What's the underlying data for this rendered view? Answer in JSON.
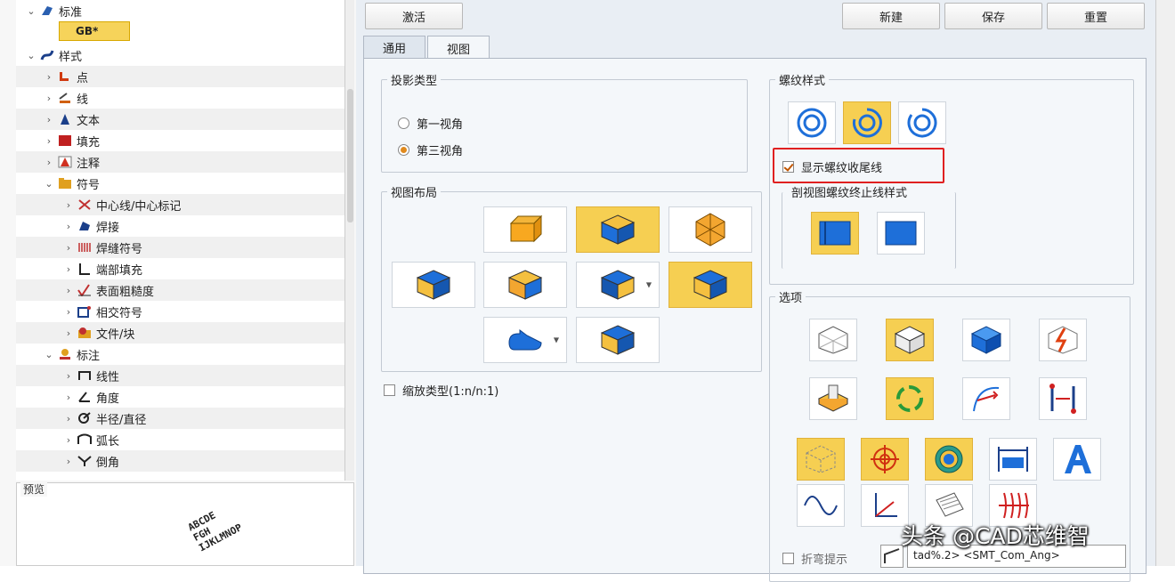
{
  "tree": {
    "gb_value": "GB*",
    "items": [
      {
        "label": "标准",
        "icon": "standard-icon"
      },
      {
        "label": "样式",
        "icon": "style-icon"
      },
      {
        "label": "点",
        "icon": "point-icon"
      },
      {
        "label": "线",
        "icon": "line-icon"
      },
      {
        "label": "文本",
        "icon": "text-icon"
      },
      {
        "label": "填充",
        "icon": "fill-icon"
      },
      {
        "label": "注释",
        "icon": "annotation-icon"
      },
      {
        "label": "符号",
        "icon": "symbol-icon"
      },
      {
        "label": "中心线/中心标记",
        "icon": "centerline-icon"
      },
      {
        "label": "焊接",
        "icon": "weld-icon"
      },
      {
        "label": "焊缝符号",
        "icon": "weld-symbol-icon"
      },
      {
        "label": "端部填充",
        "icon": "end-fill-icon"
      },
      {
        "label": "表面粗糙度",
        "icon": "roughness-icon"
      },
      {
        "label": "相交符号",
        "icon": "intersect-icon"
      },
      {
        "label": "文件/块",
        "icon": "file-block-icon"
      },
      {
        "label": "标注",
        "icon": "dimension-icon"
      },
      {
        "label": "线性",
        "icon": "linear-icon"
      },
      {
        "label": "角度",
        "icon": "angle-icon"
      },
      {
        "label": "半径/直径",
        "icon": "radius-icon"
      },
      {
        "label": "弧长",
        "icon": "arc-length-icon"
      },
      {
        "label": "倒角",
        "icon": "chamfer-icon"
      }
    ]
  },
  "preview": {
    "title": "预览",
    "sample_text": "ABCDE\nFGH\nIJKLMNOP"
  },
  "toolbar": {
    "activate": "激活",
    "new": "新建",
    "save": "保存",
    "reset": "重置"
  },
  "tabs": {
    "general": "通用",
    "view": "视图"
  },
  "projection": {
    "title": "投影类型",
    "first_angle": "第一视角",
    "third_angle": "第三视角"
  },
  "layout": {
    "title": "视图布局"
  },
  "scale_type": {
    "label": "缩放类型(1:n/n:1)"
  },
  "thread": {
    "title": "螺纹样式",
    "show_runout": "显示螺纹收尾线",
    "section_title": "剖视图螺纹终止线样式"
  },
  "options": {
    "title": "选项",
    "fold_hint": "折弯提示",
    "field_value": "tad%.2> <SMT_Com_Ang>"
  },
  "watermark": "头条 @CAD芯维智",
  "colors": {
    "selected_tile": "#f6cf52",
    "highlight_box": "#e02020",
    "blue_accent": "#1e6fd9"
  }
}
